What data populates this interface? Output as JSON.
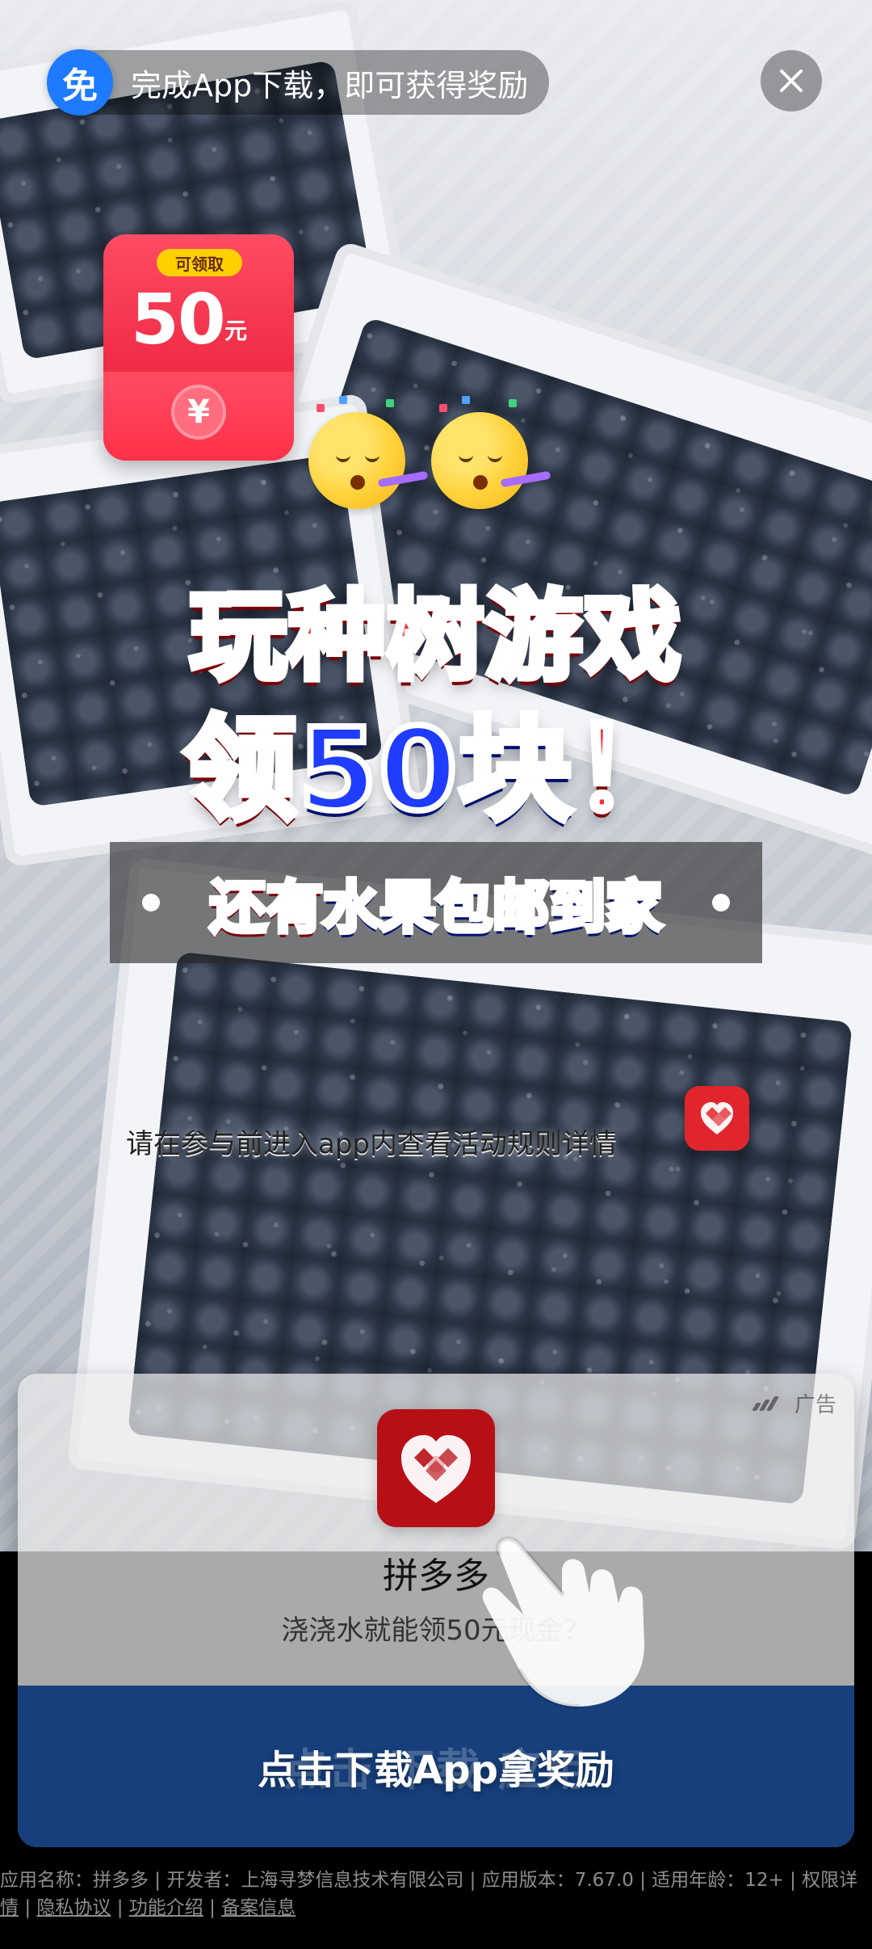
{
  "top_pill": {
    "badge": "免",
    "text": "完成App下载，即可获得奖励"
  },
  "red_packet": {
    "chip": "可领取",
    "amount": "50",
    "unit": "元",
    "coin": "¥"
  },
  "headline": {
    "line1": "玩种树游戏",
    "line2_red": "领",
    "line2_blue": "50块",
    "line2_red2": "！"
  },
  "banner": {
    "red1": "还有",
    "blue": "水果包邮到家",
    "red2": ""
  },
  "rule_text": "请在参与前进入app内查看活动规则详情",
  "ad_card": {
    "ad_label": "广告",
    "app_name": "拼多多",
    "app_desc": "浇浇水就能领50元现金？",
    "cta_ghost": "点击  下载  应用",
    "cta_label": "点击下载App拿奖励"
  },
  "footer": {
    "line1": "应用名称：拼多多 | 开发者：上海寻梦信息技术有限公司 | 应用版本：7.67.0 | 适用年龄：12+ | 权限详",
    "link_permissions_tail": "情",
    "link_privacy": "隐私协议",
    "link_features": "功能介绍",
    "link_filing": "备案信息"
  },
  "icons": {
    "close": "close-icon",
    "pdd": "pinduoduo-logo-icon",
    "hand": "hand-pointer-icon",
    "ad": "ad-mark-icon"
  },
  "colors": {
    "cta_bg": "#163f7c",
    "red": "#ff2b39",
    "blue": "#1f3cff",
    "free_badge": "#1e7bff",
    "pdd_red": "#b70f16"
  }
}
